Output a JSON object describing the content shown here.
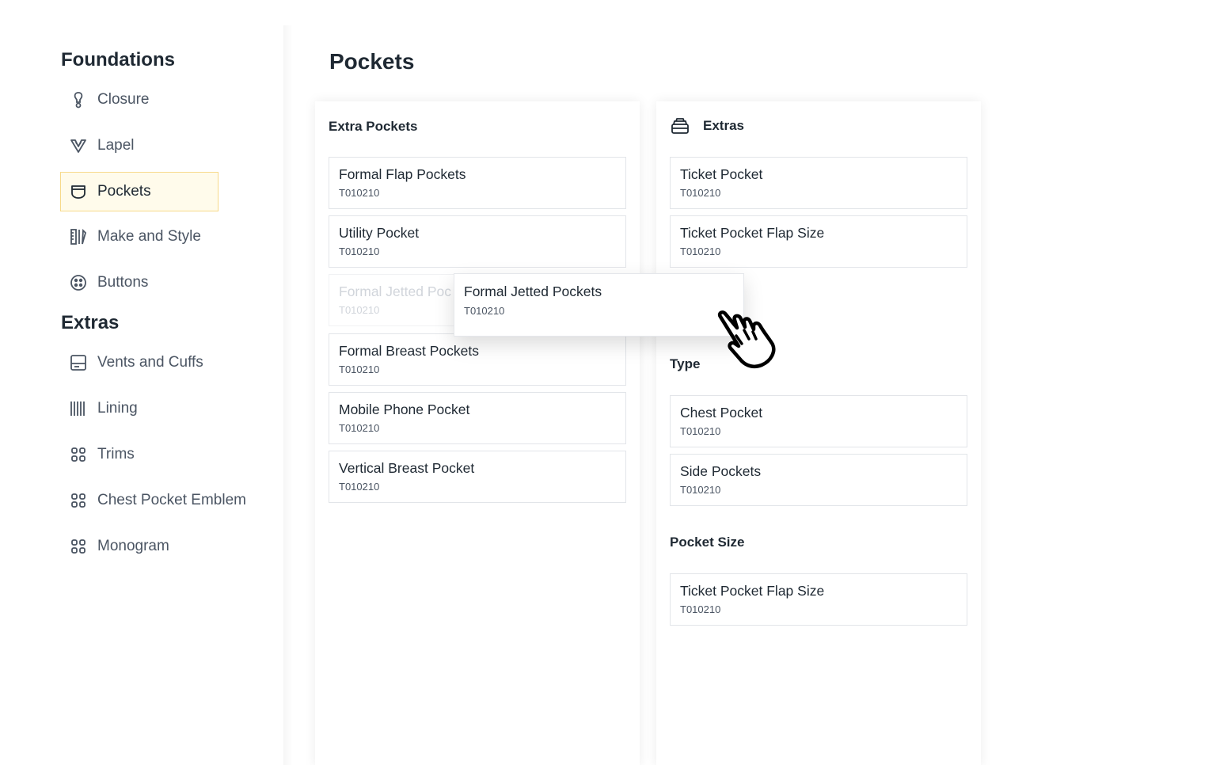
{
  "sidebar": {
    "foundations_title": "Foundations",
    "foundations": [
      {
        "label": "Closure",
        "icon": "closure-icon"
      },
      {
        "label": "Lapel",
        "icon": "lapel-icon"
      },
      {
        "label": "Pockets",
        "icon": "pocket-icon",
        "active": true
      },
      {
        "label": "Make and Style",
        "icon": "make-style-icon"
      },
      {
        "label": "Buttons",
        "icon": "button-icon"
      }
    ],
    "extras_title": "Extras",
    "extras": [
      {
        "label": "Vents and Cuffs",
        "icon": "vents-icon"
      },
      {
        "label": "Lining",
        "icon": "lining-icon"
      },
      {
        "label": "Trims",
        "icon": "grid-icon"
      },
      {
        "label": "Chest Pocket Emblem",
        "icon": "grid-icon"
      },
      {
        "label": "Monogram",
        "icon": "grid-icon"
      }
    ]
  },
  "main": {
    "title": "Pockets",
    "left_panel": {
      "title": "Extra Pockets",
      "cards": [
        {
          "title": "Formal Flap Pockets",
          "code": "T010210"
        },
        {
          "title": "Utility Pocket",
          "code": "T010210"
        },
        {
          "title": "Formal Jetted Poc",
          "code": "T010210",
          "ghost": true
        },
        {
          "title": "Formal Breast Pockets",
          "code": "T010210"
        },
        {
          "title": "Mobile Phone Pocket",
          "code": "T010210"
        },
        {
          "title": "Vertical Breast Pocket",
          "code": "T010210"
        }
      ]
    },
    "right_panel": {
      "title": "Extras",
      "cards": [
        {
          "title": "Ticket Pocket",
          "code": "T010210"
        },
        {
          "title": "Ticket Pocket Flap Size",
          "code": "T010210"
        }
      ],
      "type_title": "Type",
      "type_cards": [
        {
          "title": "Chest Pocket",
          "code": "T010210"
        },
        {
          "title": "Side Pockets",
          "code": "T010210"
        }
      ],
      "size_title": "Pocket Size",
      "size_cards": [
        {
          "title": "Ticket Pocket Flap Size",
          "code": "T010210"
        }
      ]
    },
    "drag_card": {
      "title": "Formal Jetted Pockets",
      "code": "T010210"
    }
  },
  "colors": {
    "active_bg": "#fffbeb",
    "active_border": "#f7d98a",
    "text": "#1f2933",
    "muted": "#4b5563"
  }
}
